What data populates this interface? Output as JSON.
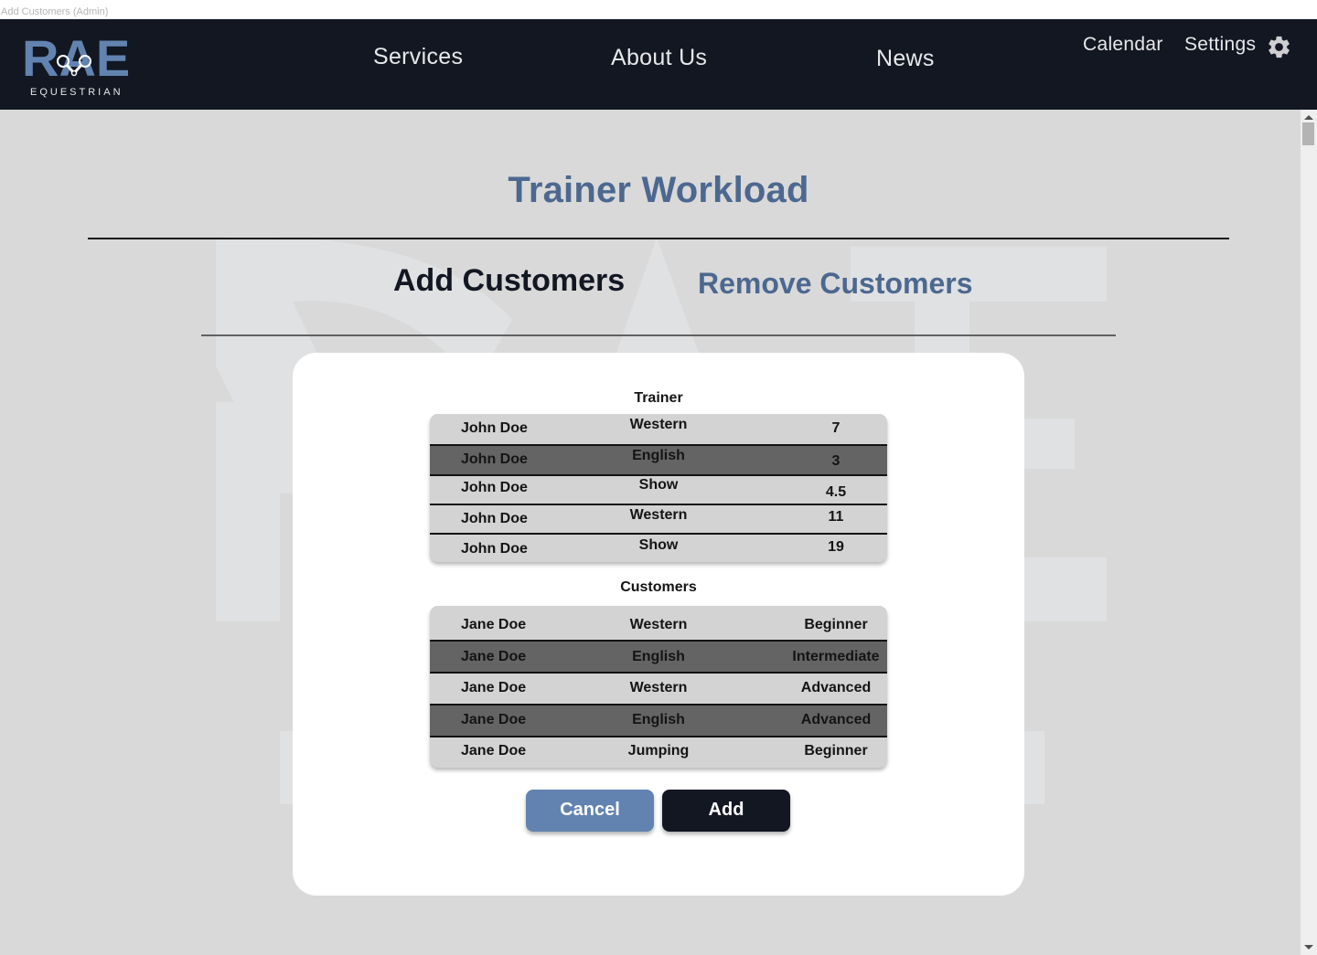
{
  "window": {
    "title": "Add Customers (Admin)"
  },
  "brand": {
    "logo_text": "RAE",
    "logo_subtext": "EQUESTRIAN",
    "primary_color": "#6283b0",
    "dark_color": "#121722",
    "title_color": "#4c6890"
  },
  "nav": {
    "links": [
      {
        "label": "Services"
      },
      {
        "label": "About Us"
      },
      {
        "label": "News"
      },
      {
        "label": "Calendar"
      },
      {
        "label": "Settings"
      }
    ],
    "settings_icon": "gear-icon"
  },
  "page": {
    "title": "Trainer Workload",
    "tabs": [
      {
        "label": "Add Customers",
        "active": true
      },
      {
        "label": "Remove Customers",
        "active": false
      }
    ]
  },
  "trainer_section": {
    "label": "Trainer",
    "rows": [
      {
        "name": "John Doe",
        "discipline": "Western",
        "value": "7",
        "highlighted": false
      },
      {
        "name": "John Doe",
        "discipline": "English",
        "value": "3",
        "highlighted": true
      },
      {
        "name": "John Doe",
        "discipline": "Show",
        "value": "4.5",
        "highlighted": false
      },
      {
        "name": "John Doe",
        "discipline": "Western",
        "value": "11",
        "highlighted": false
      },
      {
        "name": "John Doe",
        "discipline": "Show",
        "value": "19",
        "highlighted": false
      }
    ]
  },
  "customers_section": {
    "label": "Customers",
    "rows": [
      {
        "name": "Jane Doe",
        "discipline": "Western",
        "level": "Beginner",
        "highlighted": false
      },
      {
        "name": "Jane Doe",
        "discipline": "English",
        "level": "Intermediate",
        "highlighted": true
      },
      {
        "name": "Jane Doe",
        "discipline": "Western",
        "level": "Advanced",
        "highlighted": false
      },
      {
        "name": "Jane Doe",
        "discipline": "English",
        "level": "Advanced",
        "highlighted": true
      },
      {
        "name": "Jane Doe",
        "discipline": "Jumping",
        "level": "Beginner",
        "highlighted": false
      }
    ]
  },
  "actions": {
    "cancel_label": "Cancel",
    "add_label": "Add"
  }
}
